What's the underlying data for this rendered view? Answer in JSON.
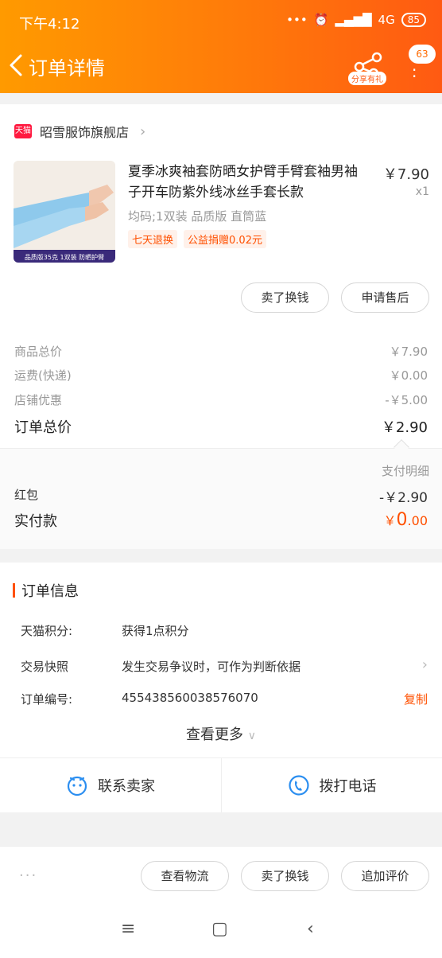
{
  "status_bar": {
    "time": "下午4:12",
    "signal": "4G",
    "battery": "85"
  },
  "nav": {
    "title": "订单详情",
    "share_label": "分享有礼",
    "badge_count": "63"
  },
  "store": {
    "badge": "天猫",
    "name": "昭雪服饰旗舰店"
  },
  "product": {
    "title": "夏季冰爽袖套防晒女护臂手臂套袖男袖子开车防紫外线冰丝手套长款",
    "price": "￥7.90",
    "qty": "x1",
    "sku": "均码;1双装 品质版 直筒蓝",
    "tags": [
      "七天退换",
      "公益捐赠0.02元"
    ],
    "image_caption": "品质版35克 1双装 防晒护臂"
  },
  "item_actions": {
    "sell": "卖了换钱",
    "after_sale": "申请售后"
  },
  "price_summary": {
    "goods_label": "商品总价",
    "goods_value": "￥7.90",
    "shipping_label": "运费(快递)",
    "shipping_value": "￥0.00",
    "discount_label": "店铺优惠",
    "discount_value": "-￥5.00",
    "total_label": "订单总价",
    "total_value": "￥2.90",
    "pay_detail": "支付明细",
    "redpacket_label": "红包",
    "redpacket_value": "-￥2.90",
    "actual_label": "实付款",
    "actual_symbol": "￥",
    "actual_int": "0",
    "actual_dec": ".00"
  },
  "order_info": {
    "heading": "订单信息",
    "points_label": "天猫积分:",
    "points_value": "获得1点积分",
    "snapshot_label": "交易快照",
    "snapshot_value": "发生交易争议时，可作为判断依据",
    "number_label": "订单编号:",
    "number_value": "455438560038576070",
    "copy": "复制",
    "see_more": "查看更多",
    "contact_seller": "联系卖家",
    "call": "拨打电话"
  },
  "bottom_bar": {
    "more": "···",
    "logistics": "查看物流",
    "sell": "卖了换钱",
    "review": "追加评价"
  },
  "colors": {
    "accent": "#ff5000",
    "header_start": "#ff9a00",
    "header_end": "#ff5a12",
    "link_blue": "#2b8ef0"
  }
}
